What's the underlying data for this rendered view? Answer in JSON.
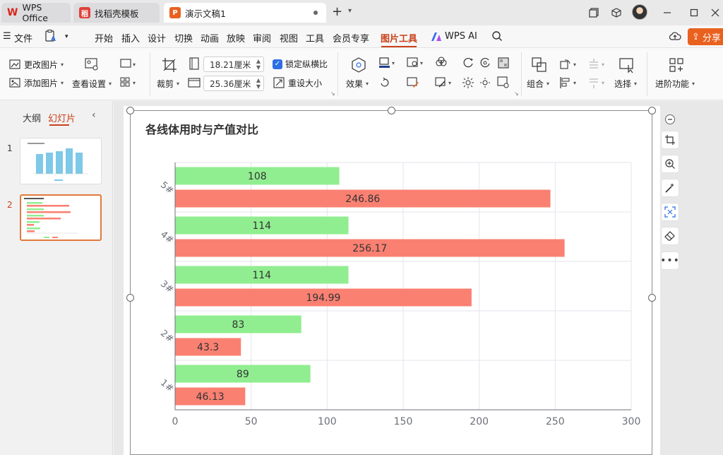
{
  "titlebar": {
    "app_tab": "WPS Office",
    "template_tab": "找稻壳模板",
    "doc_tab": "演示文稿1"
  },
  "menubar": {
    "file_label": "文件",
    "items": [
      "开始",
      "插入",
      "设计",
      "切换",
      "动画",
      "放映",
      "审阅",
      "视图",
      "工具",
      "会员专享",
      "图片工具",
      "WPS AI"
    ],
    "active_item": "图片工具",
    "share_label": "分享"
  },
  "ribbon": {
    "change_picture": "更改图片",
    "add_picture": "添加图片",
    "view_settings": "查看设置",
    "crop": "裁剪",
    "height_value": "18.21厘米",
    "width_value": "25.36厘米",
    "lock_ratio": "锁定纵横比",
    "reset_size": "重设大小",
    "effects": "效果",
    "group": "组合",
    "select": "选择",
    "advanced": "进阶功能"
  },
  "leftpanel": {
    "outline_tab": "大纲",
    "slides_tab": "幻灯片",
    "slide_numbers": [
      "1",
      "2"
    ]
  },
  "colors": {
    "accent": "#c9411a",
    "share_orange": "#e9611f",
    "bar_green": "#90ee90",
    "bar_red": "#fa8072",
    "thumb_bar_blue": "#7ec8e8"
  },
  "chart_data": {
    "type": "bar",
    "orientation": "horizontal",
    "title": "各线体用时与产值对比",
    "categories": [
      "1#",
      "2#",
      "3#",
      "4#",
      "5#"
    ],
    "series": [
      {
        "values": [
          89,
          83,
          114,
          114,
          108
        ],
        "color": "#90ee90"
      },
      {
        "values": [
          46.13,
          43.3,
          194.99,
          256.17,
          246.86
        ],
        "color": "#fa8072"
      }
    ],
    "value_labels": [
      [
        "89",
        "83",
        "114",
        "114",
        "108"
      ],
      [
        "46.13",
        "43.3",
        "194.99",
        "256.17",
        "246.86"
      ]
    ],
    "xlim": [
      0,
      300
    ],
    "xticks": [
      "0",
      "50",
      "100",
      "150",
      "200",
      "250",
      "300"
    ],
    "grid": true,
    "legend": "none"
  }
}
